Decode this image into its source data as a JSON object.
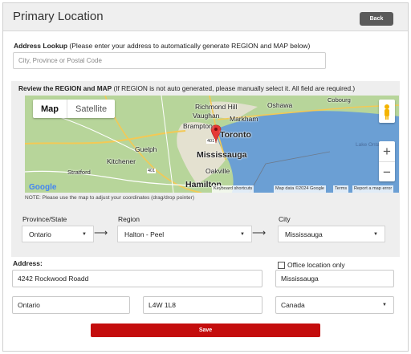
{
  "header": {
    "title": "Primary Location",
    "back_label": "Back"
  },
  "lookup": {
    "label_bold": "Address Lookup",
    "label_rest": " (Please enter your address to automatically generate REGION and MAP below)",
    "placeholder": "City, Province or Postal Code"
  },
  "review": {
    "title_bold": "Review the REGION and MAP",
    "title_rest": " (If REGION is not auto generated, please manually select it. All field are required.)"
  },
  "map": {
    "map_type_map": "Map",
    "map_type_satellite": "Satellite",
    "zoom_in": "+",
    "zoom_out": "−",
    "labels": {
      "richmond_hill": "Richmond Hill",
      "oshawa": "Oshawa",
      "cobourg": "Cobourg",
      "vaughan": "Vaughan",
      "markham": "Markham",
      "brampton": "Brampton",
      "toronto": "Toronto",
      "guelph": "Guelph",
      "mississauga": "Mississauga",
      "kitchener": "Kitchener",
      "oakville": "Oakville",
      "stratford": "Stratford",
      "hamilton": "Hamilton",
      "lake_ontario": "Lake Ontario",
      "hwy_401": "401",
      "hwy_401b": "401"
    },
    "footer": {
      "google": "Google",
      "shortcuts": "Keyboard shortcuts",
      "data": "Map data ©2024 Google",
      "terms": "Terms",
      "report": "Report a map error"
    },
    "colors": {
      "land": "#b7d59a",
      "water": "#6b9fd4",
      "urban": "#e9e2d6",
      "marker": "#e53935"
    }
  },
  "note": "NOTE: Please use the map to adjust your coordinates (drag/drop pointer)",
  "region_selectors": {
    "province_label": "Province/State",
    "province_value": "Ontario",
    "region_label": "Region",
    "region_value": "Halton - Peel",
    "city_label": "City",
    "city_value": "Mississauga"
  },
  "address": {
    "label": "Address:",
    "street": "4242 Rockwood Roadd",
    "office_only_label": "Office location only",
    "office_only_checked": false,
    "city": "Mississauga",
    "province": "Ontario",
    "postal": "L4W 1L8",
    "country": "Canada"
  },
  "save_label": "Save"
}
